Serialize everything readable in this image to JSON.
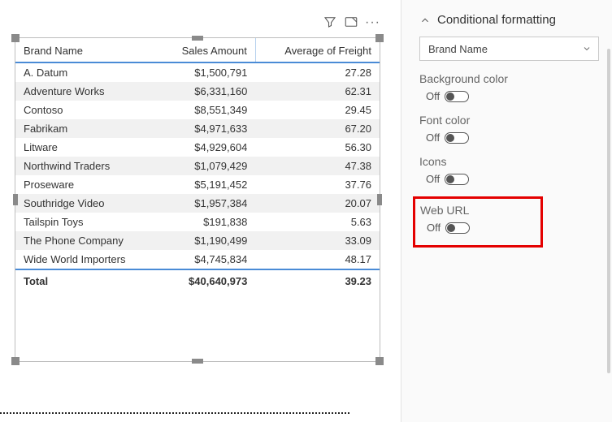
{
  "toolbar": {
    "filter_icon": "filter",
    "focus_icon": "focus-mode",
    "more_icon": "more"
  },
  "table": {
    "columns": [
      "Brand Name",
      "Sales Amount",
      "Average of Freight"
    ],
    "rows": [
      {
        "brand": "A. Datum",
        "sales": "$1,500,791",
        "freight": "27.28"
      },
      {
        "brand": "Adventure Works",
        "sales": "$6,331,160",
        "freight": "62.31"
      },
      {
        "brand": "Contoso",
        "sales": "$8,551,349",
        "freight": "29.45"
      },
      {
        "brand": "Fabrikam",
        "sales": "$4,971,633",
        "freight": "67.20"
      },
      {
        "brand": "Litware",
        "sales": "$4,929,604",
        "freight": "56.30"
      },
      {
        "brand": "Northwind Traders",
        "sales": "$1,079,429",
        "freight": "47.38"
      },
      {
        "brand": "Proseware",
        "sales": "$5,191,452",
        "freight": "37.76"
      },
      {
        "brand": "Southridge Video",
        "sales": "$1,957,384",
        "freight": "20.07"
      },
      {
        "brand": "Tailspin Toys",
        "sales": "$191,838",
        "freight": "5.63"
      },
      {
        "brand": "The Phone Company",
        "sales": "$1,190,499",
        "freight": "33.09"
      },
      {
        "brand": "Wide World Importers",
        "sales": "$4,745,834",
        "freight": "48.17"
      }
    ],
    "total": {
      "label": "Total",
      "sales": "$40,640,973",
      "freight": "39.23"
    }
  },
  "panel": {
    "section_title": "Conditional formatting",
    "field_selected": "Brand Name",
    "options": {
      "bg": {
        "label": "Background color",
        "state": "Off"
      },
      "font": {
        "label": "Font color",
        "state": "Off"
      },
      "icons": {
        "label": "Icons",
        "state": "Off"
      },
      "url": {
        "label": "Web URL",
        "state": "Off"
      }
    }
  }
}
